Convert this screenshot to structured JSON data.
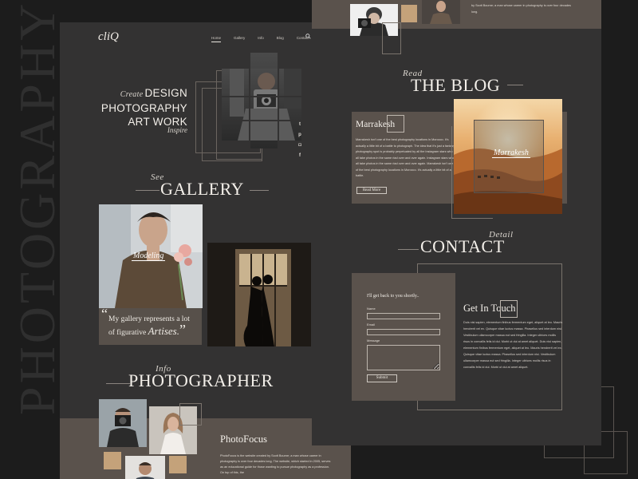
{
  "background_word": "PHOTOGRAPHY",
  "left": {
    "logo": "cliQ",
    "nav": [
      "Home",
      "Gallery",
      "Info",
      "Blog",
      "Contact"
    ],
    "hero": {
      "pre": "Create",
      "line1": "DESIGN",
      "line2": "PHOTOGRAPHY",
      "line3": "ART WORK",
      "post": "Inspire"
    },
    "social": [
      "t",
      "p",
      "◘",
      "f"
    ],
    "gallery": {
      "pre": "See",
      "title": "GALLERY",
      "image_label": "Modeling",
      "quote_1": "My gallery represents a lot",
      "quote_2": "of figurative",
      "quote_art": "Artises.",
      "open_mark": "“",
      "close_mark": "”"
    },
    "photographer": {
      "pre": "Info",
      "title": "PHOTOGRAPHER",
      "name": "PhotoFocus",
      "text": "PhotoFocus is the website created by Scott Bourne; a man whose career in photography is over four decades long. The website, which started in 2005, serves as an educational guide for those wanting to pursue photography as a profession. On top of this, the"
    }
  },
  "right": {
    "top_text": "by Scott Bourne; a man whose career in photography is over four decades long.",
    "blog": {
      "pre": "Read",
      "title": "THE BLOG",
      "post_title": "Marrakesh",
      "image_label": "Marrakesh",
      "text": "Marrakesh isn't one of the best photography locations in Morocco. It's actually a little bit of a battle to photograph. The idea that it's just a fantasy photography spot is probably perpetuated by all the Instagram stars who all take photos in the same riad over and over again. Instagram stars who all take photos in the same riad over and over again. Marrakesh isn't one of the best photography locations in Morocco. It's actually a little bit of a battle.",
      "read_more": "Read More"
    },
    "contact": {
      "pre": "Detail",
      "title": "CONTACT",
      "form_heading": "I'll get back to you shortly..",
      "name_label": "Name",
      "email_label": "Email",
      "message_label": "Message",
      "submit": "Submit",
      "get_in_touch": "Get In Touch",
      "text": "Duis nisi sapien, elementum finibus fermentum eget, aliquet at leo. Mauris hendrerit vel ex. Quisque vitae luctus massa. Phasellus sed interdum nisi. Vestibulum ullamcorper massa eut sed fringilla. Integer ultrices mollis risus in convallis felis id dui. Morbi ut dui at amet aliquet. Duis nisi sapien, elementum finibus fermentum eget, aliquet at leo. Mauris hendrerit vel ex. Quisque vitae luctus massa. Phasellus sed interdum nisi. Vestibulum ullamcorper massa eut sed fringilla. Integer ultrices mollis risus in convallis felis id dui. Morbi ut dui at amet aliquet."
    }
  },
  "colors": {
    "page": "#333232",
    "band": "#5a524c",
    "backdrop": "#1c1c1c",
    "accent_tan": "#c4a27a"
  }
}
